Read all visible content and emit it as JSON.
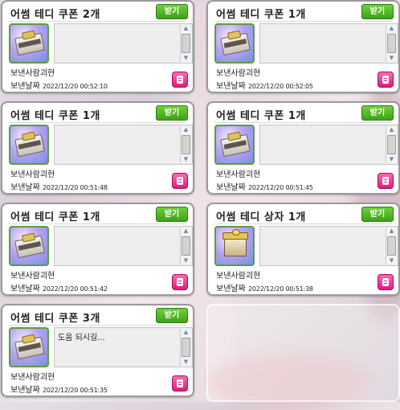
{
  "sender_label": "보낸사람",
  "date_label": "보낸날짜",
  "receive_label": "받기",
  "cards": [
    {
      "title": "어썸 테디 쿠폰 2개",
      "sender": "괴현",
      "date": "2022/12/20 00:52:10",
      "message": "",
      "icon": "teddy-coupon-icon"
    },
    {
      "title": "어썸 테디 쿠폰 1개",
      "sender": "괴현",
      "date": "2022/12/20 00:52:05",
      "message": "",
      "icon": "teddy-coupon-icon"
    },
    {
      "title": "어썸 테디 쿠폰 1개",
      "sender": "괴현",
      "date": "2022/12/20 00:51:48",
      "message": "",
      "icon": "teddy-coupon-icon"
    },
    {
      "title": "어썸 테디 쿠폰 1개",
      "sender": "괴현",
      "date": "2022/12/20 00:51:45",
      "message": "",
      "icon": "teddy-coupon-icon"
    },
    {
      "title": "어썸 테디 쿠폰 1개",
      "sender": "괴현",
      "date": "2022/12/20 00:51:42",
      "message": "",
      "icon": "teddy-coupon-icon"
    },
    {
      "title": "어썸 테디 상자 1개",
      "sender": "괴현",
      "date": "2022/12/20 00:51:38",
      "message": "",
      "icon": "teddy-box-icon"
    },
    {
      "title": "어썸 테디 쿠폰 3개",
      "sender": "괴현",
      "date": "2022/12/20 00:51:35",
      "message": "도움 되시길...",
      "icon": "teddy-coupon-icon"
    }
  ],
  "colors": {
    "receive_button": "#4fb826",
    "delete_button": "#e8258a",
    "icon_border": "#5a9e3c"
  }
}
